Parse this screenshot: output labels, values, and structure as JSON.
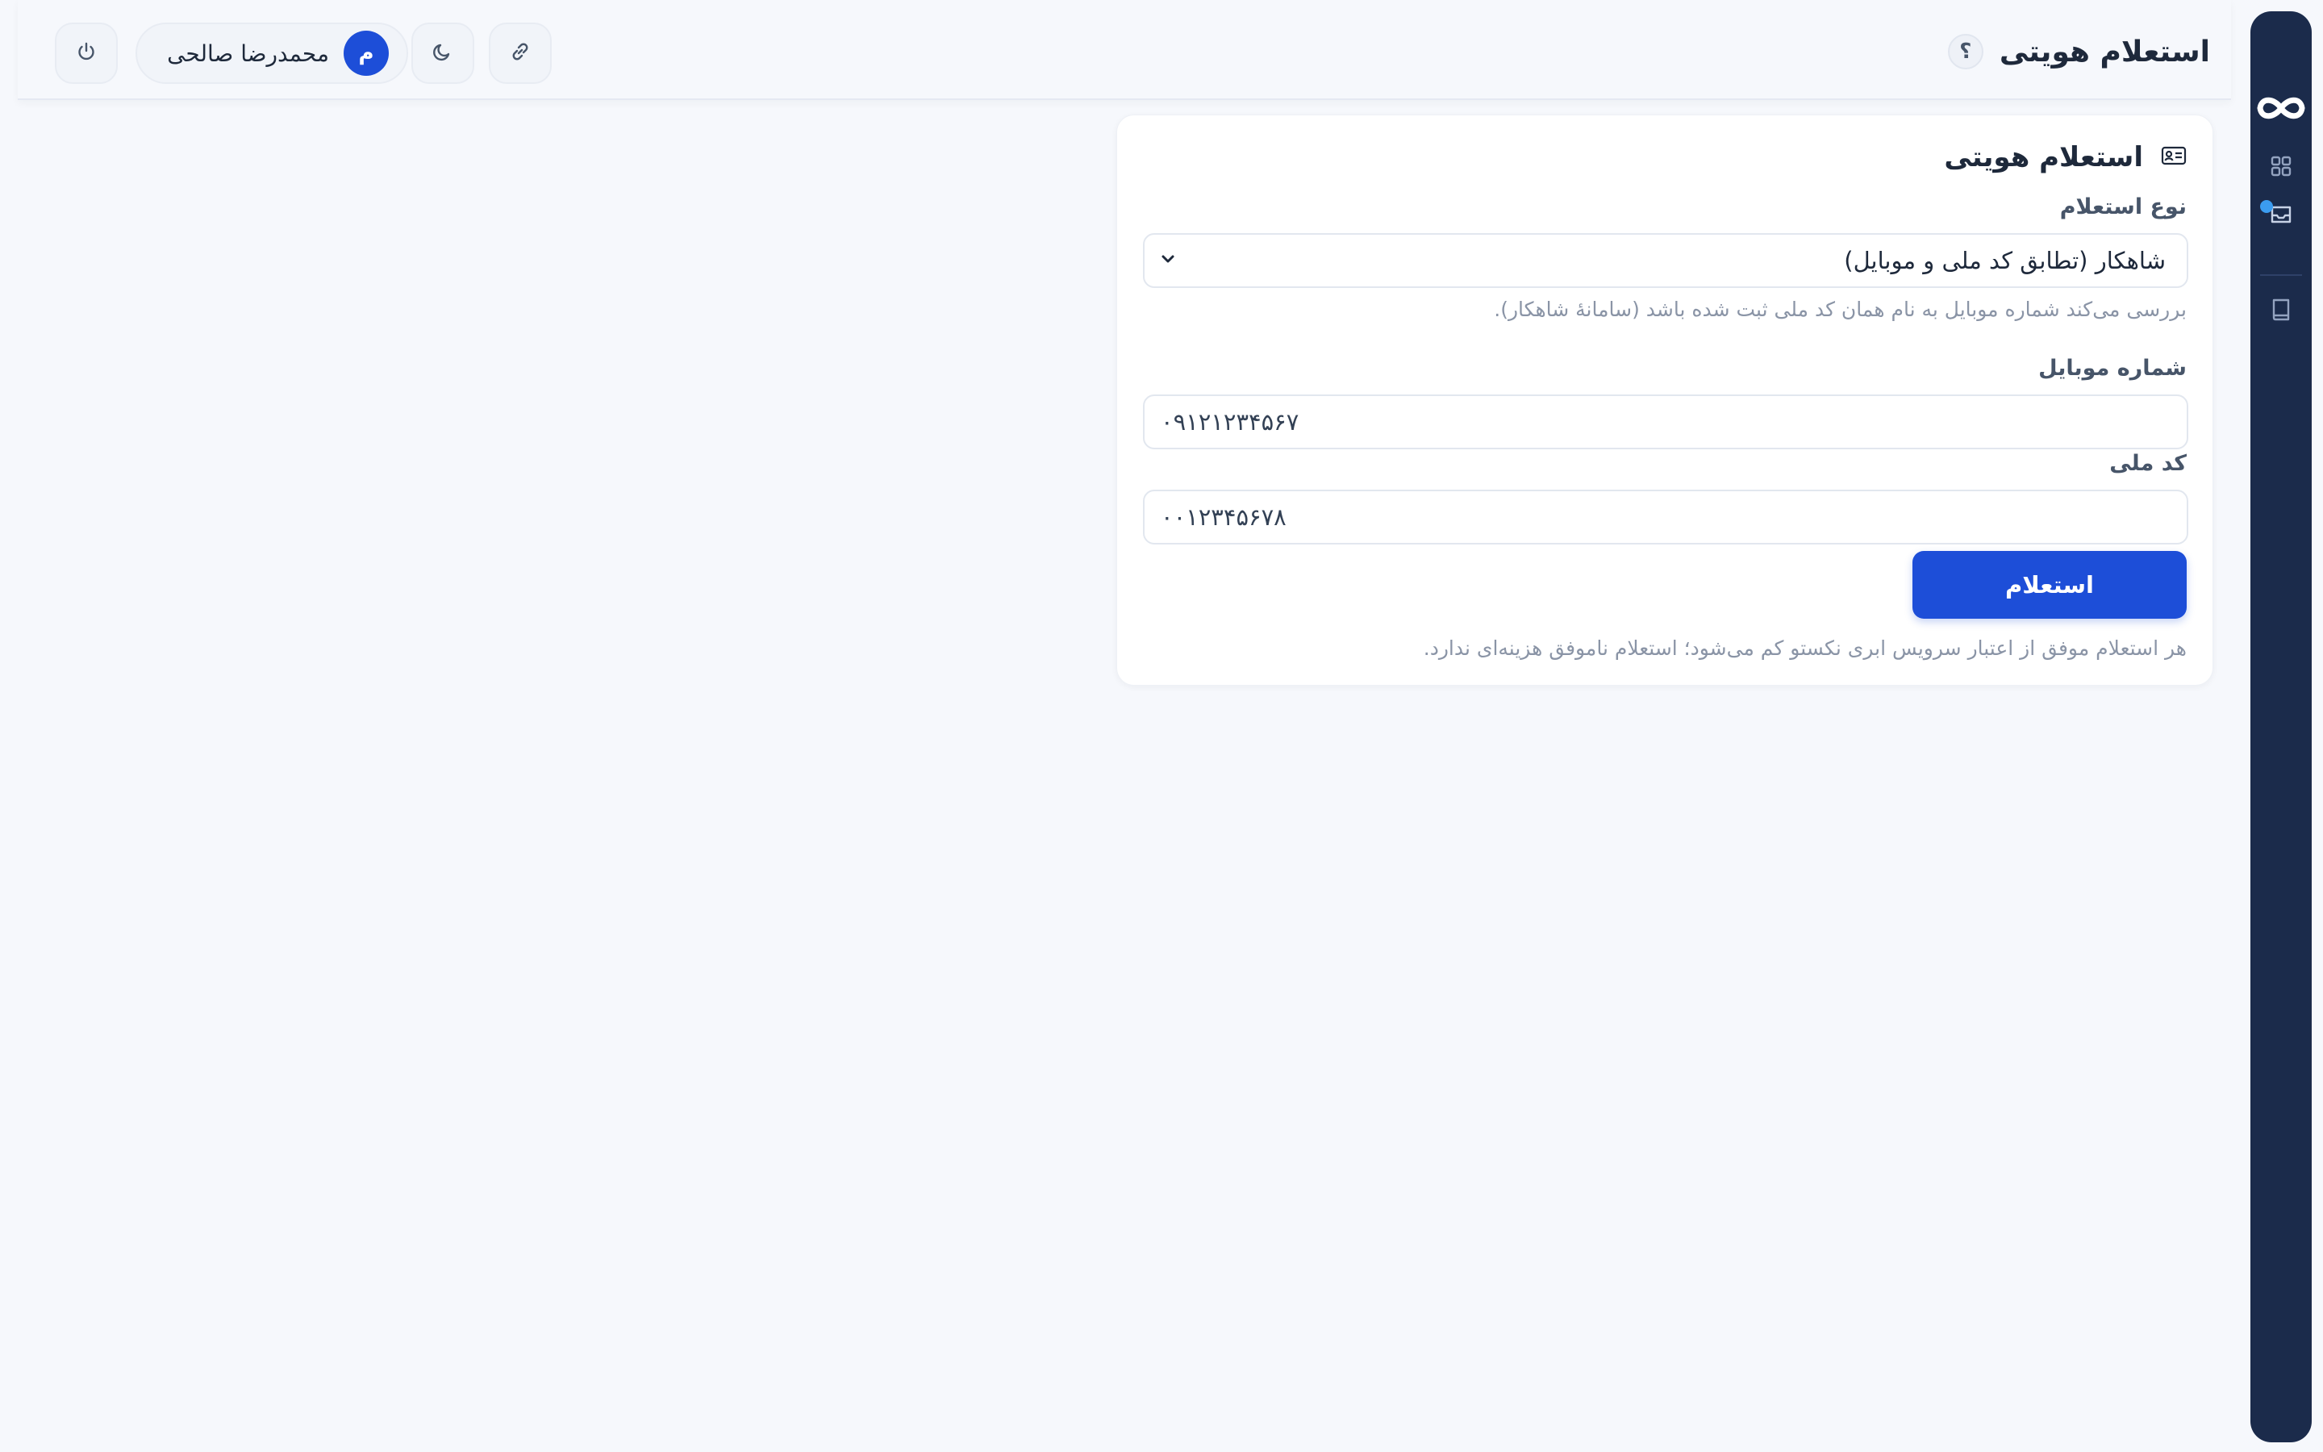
{
  "colors": {
    "sidebar_bg": "#1b2b4b",
    "primary": "#1d4ed8",
    "notification_dot": "#3b9cf0",
    "page_bg": "#f6f8fc"
  },
  "sidebar": {
    "logo": "infinity-logo",
    "items": [
      {
        "icon": "dashboard-grid-icon",
        "active": false
      },
      {
        "icon": "inbox-icon",
        "active": true,
        "has_notification": true
      },
      {
        "icon": "book-icon",
        "active": false
      }
    ]
  },
  "header": {
    "title": "استعلام هویتی",
    "help_label": "؟",
    "user": {
      "avatar_letter": "م",
      "name": "محمدرضا صالحی"
    },
    "icons": [
      "link-icon",
      "moon-icon",
      "power-icon"
    ]
  },
  "card": {
    "title": "استعلام هویتی",
    "title_icon": "id-card-icon",
    "inquiry_type": {
      "label": "نوع استعلام",
      "selected": "شاهکار (تطابق کد ملی و موبایل)",
      "hint": "بررسی می‌کند شماره موبایل به نام همان کد ملی ثبت شده باشد (سامانهٔ شاهکار)."
    },
    "mobile": {
      "label": "شماره موبایل",
      "value": "۰۹۱۲۱۲۳۴۵۶۷"
    },
    "national_code": {
      "label": "کد ملی",
      "value": "۰۰۱۲۳۴۵۶۷۸"
    },
    "submit_label": "استعلام",
    "footer_note": "هر استعلام موفق از اعتبار سرویس ابری نکستو کم می‌شود؛ استعلام ناموفق هزینه‌ای ندارد."
  }
}
